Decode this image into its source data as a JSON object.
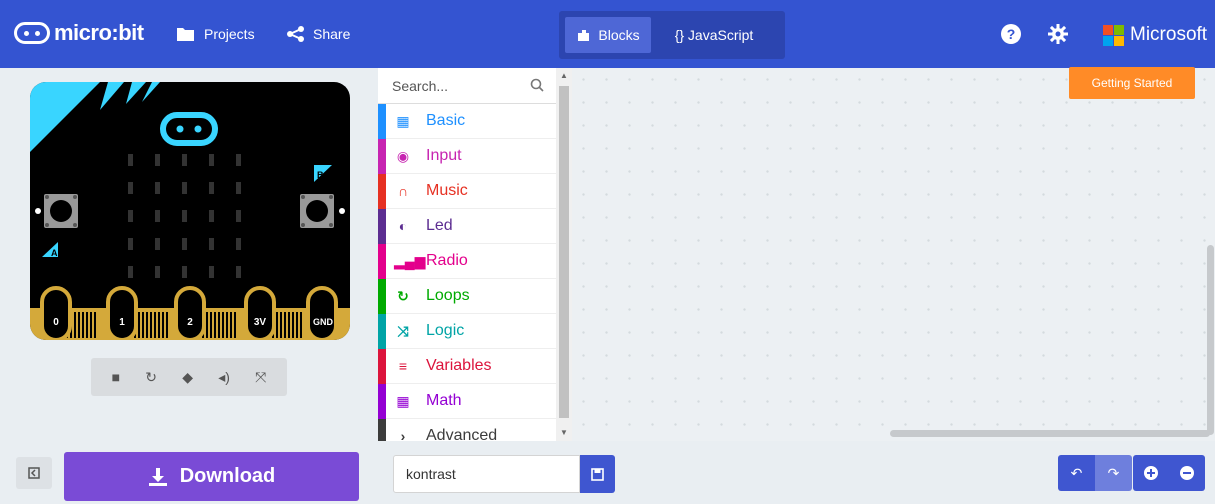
{
  "header": {
    "logo_text": "micro:bit",
    "projects_label": "Projects",
    "share_label": "Share",
    "blocks_label": "Blocks",
    "javascript_label": "{} JavaScript",
    "help_glyph": "?",
    "brand_label": "Microsoft",
    "brand_colors": [
      "#f25022",
      "#7fba00",
      "#00a4ef",
      "#ffb900"
    ]
  },
  "simulator": {
    "pins": [
      "0",
      "1",
      "2",
      "3V",
      "GND"
    ],
    "button_a": "A",
    "button_b": "B",
    "controls": [
      "stop-icon",
      "restart-icon",
      "slowmo-icon",
      "mute-icon",
      "fullscreen-icon"
    ]
  },
  "toolbox": {
    "search_placeholder": "Search...",
    "categories": [
      {
        "label": "Basic",
        "color": "#1e90ff",
        "icon": "grid-icon"
      },
      {
        "label": "Input",
        "color": "#c724b1",
        "icon": "target-icon"
      },
      {
        "label": "Music",
        "color": "#e63022",
        "icon": "headphones-icon"
      },
      {
        "label": "Led",
        "color": "#5c2d91",
        "icon": "toggle-icon"
      },
      {
        "label": "Radio",
        "color": "#e3008c",
        "icon": "signal-icon"
      },
      {
        "label": "Loops",
        "color": "#00aa00",
        "icon": "refresh-icon"
      },
      {
        "label": "Logic",
        "color": "#00a4a6",
        "icon": "shuffle-icon"
      },
      {
        "label": "Variables",
        "color": "#dc143c",
        "icon": "list-icon"
      },
      {
        "label": "Math",
        "color": "#9400d3",
        "icon": "calculator-icon"
      },
      {
        "label": "Advanced",
        "color": "#3c3c3c",
        "icon": "chevron-icon"
      }
    ]
  },
  "workspace": {
    "getting_started_label": "Getting Started"
  },
  "footer": {
    "download_label": "Download",
    "project_name": "kontrast"
  }
}
